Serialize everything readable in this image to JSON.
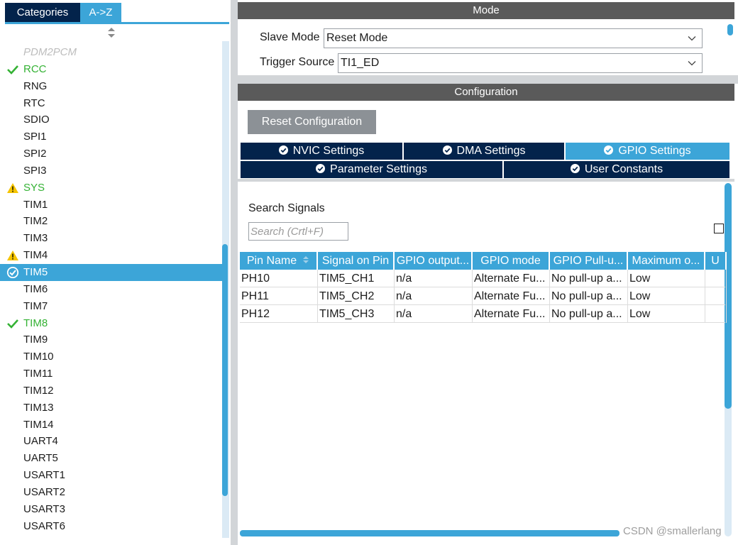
{
  "left_panel": {
    "tabs": [
      {
        "label": "Categories",
        "active": false
      },
      {
        "label": "A->Z",
        "active": true
      }
    ],
    "items": [
      {
        "label": "PDM2PCM",
        "state": "disabled"
      },
      {
        "label": "RCC",
        "state": "ok"
      },
      {
        "label": "RNG",
        "state": "normal"
      },
      {
        "label": "RTC",
        "state": "normal"
      },
      {
        "label": "SDIO",
        "state": "normal"
      },
      {
        "label": "SPI1",
        "state": "normal"
      },
      {
        "label": "SPI2",
        "state": "normal"
      },
      {
        "label": "SPI3",
        "state": "normal"
      },
      {
        "label": "SYS",
        "state": "warning-green"
      },
      {
        "label": "TIM1",
        "state": "normal"
      },
      {
        "label": "TIM2",
        "state": "normal"
      },
      {
        "label": "TIM3",
        "state": "normal"
      },
      {
        "label": "TIM4",
        "state": "warning"
      },
      {
        "label": "TIM5",
        "state": "selected"
      },
      {
        "label": "TIM6",
        "state": "normal"
      },
      {
        "label": "TIM7",
        "state": "normal"
      },
      {
        "label": "TIM8",
        "state": "ok"
      },
      {
        "label": "TIM9",
        "state": "normal"
      },
      {
        "label": "TIM10",
        "state": "normal"
      },
      {
        "label": "TIM11",
        "state": "normal"
      },
      {
        "label": "TIM12",
        "state": "normal"
      },
      {
        "label": "TIM13",
        "state": "normal"
      },
      {
        "label": "TIM14",
        "state": "normal"
      },
      {
        "label": "UART4",
        "state": "normal"
      },
      {
        "label": "UART5",
        "state": "normal"
      },
      {
        "label": "USART1",
        "state": "normal"
      },
      {
        "label": "USART2",
        "state": "normal"
      },
      {
        "label": "USART3",
        "state": "normal"
      },
      {
        "label": "USART6",
        "state": "normal"
      }
    ]
  },
  "mode": {
    "title": "Mode",
    "slave_mode_label": "Slave Mode",
    "slave_mode_value": "Reset Mode",
    "trigger_source_label": "Trigger Source",
    "trigger_source_value": "TI1_ED"
  },
  "configuration": {
    "title": "Configuration",
    "reset_button_label": "Reset Configuration",
    "tabs": [
      {
        "label": "NVIC Settings",
        "active": false
      },
      {
        "label": "DMA Settings",
        "active": false
      },
      {
        "label": "GPIO Settings",
        "active": true
      },
      {
        "label": "Parameter Settings",
        "active": false
      },
      {
        "label": "User Constants",
        "active": false
      }
    ],
    "search_label": "Search Signals",
    "search_placeholder": "Search (Crtl+F)"
  },
  "gpio_table": {
    "columns": [
      "Pin Name",
      "Signal on Pin",
      "GPIO output...",
      "GPIO mode",
      "GPIO Pull-u...",
      "Maximum o...",
      "U"
    ],
    "rows": [
      [
        "PH10",
        "TIM5_CH1",
        "n/a",
        "Alternate Fu...",
        "No pull-up a...",
        "Low",
        ""
      ],
      [
        "PH11",
        "TIM5_CH2",
        "n/a",
        "Alternate Fu...",
        "No pull-up a...",
        "Low",
        ""
      ],
      [
        "PH12",
        "TIM5_CH3",
        "n/a",
        "Alternate Fu...",
        "No pull-up a...",
        "Low",
        ""
      ]
    ]
  },
  "watermark": "CSDN @smallerlang",
  "colors": {
    "navy": "#03234b",
    "accent_blue": "#3ca5d8",
    "header_gray": "#5a5a5a",
    "ok_green": "#34b234",
    "warning_yellow": "#f5c400"
  },
  "icons": {
    "ok": "check-icon",
    "warning": "warning-triangle-icon",
    "selected": "check-circle-icon",
    "dropdown": "chevron-down-icon",
    "tab_status": "check-circle-icon",
    "sort": "sort-arrows-icon"
  }
}
